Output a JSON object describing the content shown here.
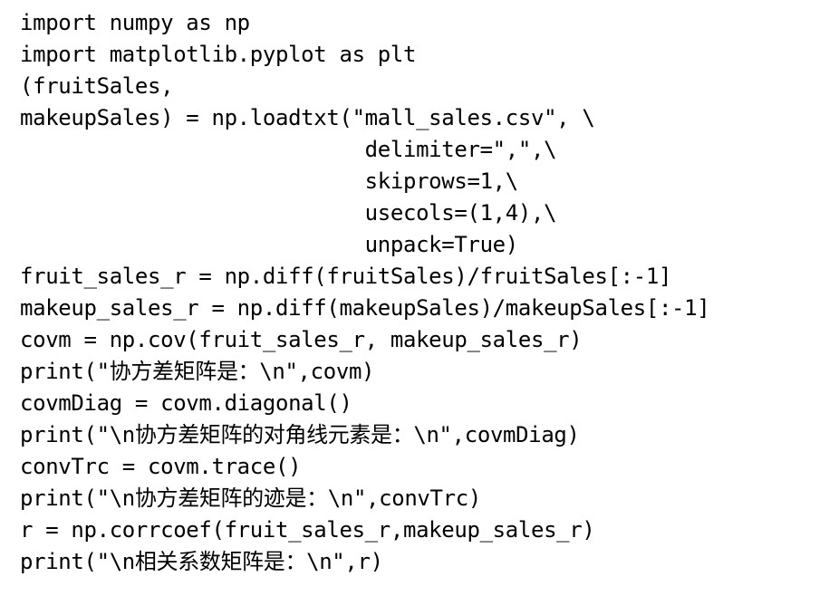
{
  "code": {
    "lines": [
      "import numpy as np",
      "import matplotlib.pyplot as plt",
      "(fruitSales,",
      "makeupSales) = np.loadtxt(\"mall_sales.csv\", \\",
      "                           delimiter=\",\",\\",
      "                           skiprows=1,\\",
      "                           usecols=(1,4),\\",
      "                           unpack=True)",
      "fruit_sales_r = np.diff(fruitSales)/fruitSales[:-1]",
      "makeup_sales_r = np.diff(makeupSales)/makeupSales[:-1]",
      "covm = np.cov(fruit_sales_r, makeup_sales_r)",
      "print(\"协方差矩阵是：\\n\",covm)",
      "covmDiag = covm.diagonal()",
      "print(\"\\n协方差矩阵的对角线元素是：\\n\",covmDiag)",
      "convTrc = covm.trace()",
      "print(\"\\n协方差矩阵的迹是：\\n\",convTrc)",
      "r = np.corrcoef(fruit_sales_r,makeup_sales_r)",
      "print(\"\\n相关系数矩阵是：\\n\",r)"
    ]
  }
}
